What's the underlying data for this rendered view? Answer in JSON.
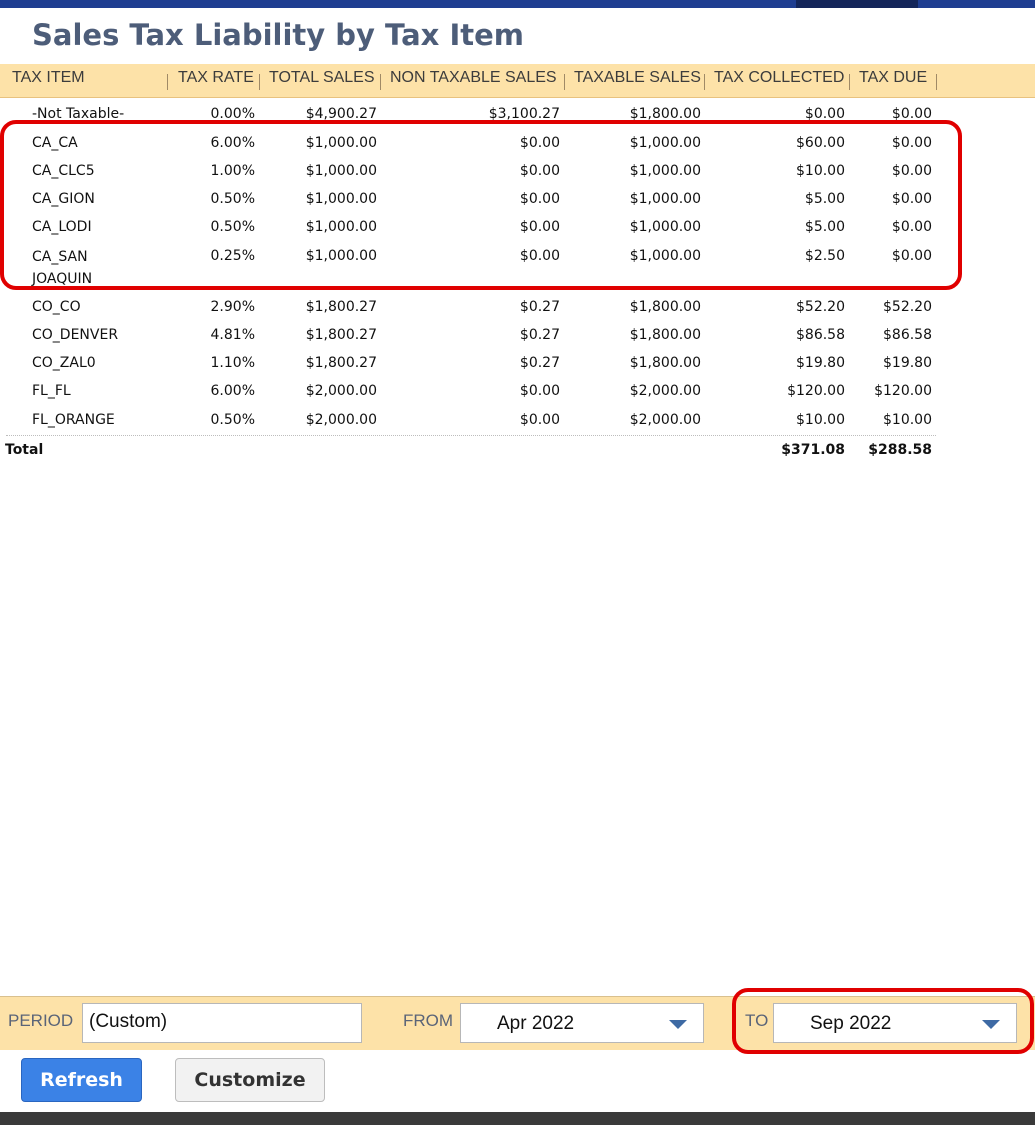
{
  "page": {
    "title": "Sales Tax Liability by Tax Item"
  },
  "table": {
    "headers": {
      "tax_item": "TAX ITEM",
      "tax_rate": "TAX RATE",
      "total_sales": "TOTAL SALES",
      "non_taxable_sales": "NON TAXABLE SALES",
      "taxable_sales": "TAXABLE SALES",
      "tax_collected": "TAX COLLECTED",
      "tax_due": "TAX DUE"
    },
    "rows": [
      {
        "item": "-Not Taxable-",
        "rate": "0.00%",
        "total": "$4,900.27",
        "nontax": "$3,100.27",
        "taxable": "$1,800.00",
        "collected": "$0.00",
        "due": "$0.00"
      },
      {
        "item": "CA_CA",
        "rate": "6.00%",
        "total": "$1,000.00",
        "nontax": "$0.00",
        "taxable": "$1,000.00",
        "collected": "$60.00",
        "due": "$0.00"
      },
      {
        "item": "CA_CLC5",
        "rate": "1.00%",
        "total": "$1,000.00",
        "nontax": "$0.00",
        "taxable": "$1,000.00",
        "collected": "$10.00",
        "due": "$0.00"
      },
      {
        "item": "CA_GION",
        "rate": "0.50%",
        "total": "$1,000.00",
        "nontax": "$0.00",
        "taxable": "$1,000.00",
        "collected": "$5.00",
        "due": "$0.00"
      },
      {
        "item": "CA_LODI",
        "rate": "0.50%",
        "total": "$1,000.00",
        "nontax": "$0.00",
        "taxable": "$1,000.00",
        "collected": "$5.00",
        "due": "$0.00"
      },
      {
        "item": "CA_SAN JOAQUIN",
        "rate": "0.25%",
        "total": "$1,000.00",
        "nontax": "$0.00",
        "taxable": "$1,000.00",
        "collected": "$2.50",
        "due": "$0.00"
      },
      {
        "item": "CO_CO",
        "rate": "2.90%",
        "total": "$1,800.27",
        "nontax": "$0.27",
        "taxable": "$1,800.00",
        "collected": "$52.20",
        "due": "$52.20"
      },
      {
        "item": "CO_DENVER",
        "rate": "4.81%",
        "total": "$1,800.27",
        "nontax": "$0.27",
        "taxable": "$1,800.00",
        "collected": "$86.58",
        "due": "$86.58"
      },
      {
        "item": "CO_ZAL0",
        "rate": "1.10%",
        "total": "$1,800.27",
        "nontax": "$0.27",
        "taxable": "$1,800.00",
        "collected": "$19.80",
        "due": "$19.80"
      },
      {
        "item": "FL_FL",
        "rate": "6.00%",
        "total": "$2,000.00",
        "nontax": "$0.00",
        "taxable": "$2,000.00",
        "collected": "$120.00",
        "due": "$120.00"
      },
      {
        "item": "FL_ORANGE",
        "rate": "0.50%",
        "total": "$2,000.00",
        "nontax": "$0.00",
        "taxable": "$2,000.00",
        "collected": "$10.00",
        "due": "$10.00"
      }
    ],
    "total": {
      "label": "Total",
      "collected": "$371.08",
      "due": "$288.58"
    }
  },
  "filters": {
    "period_label": "PERIOD",
    "period_value": "(Custom)",
    "from_label": "FROM",
    "from_value": "Apr 2022",
    "to_label": "TO",
    "to_value": "Sep 2022"
  },
  "buttons": {
    "refresh": "Refresh",
    "customize": "Customize"
  },
  "colors": {
    "header_bg": "#fde2a8",
    "highlight": "#e00000",
    "primary_button": "#3b82e6",
    "title": "#4d5d79"
  }
}
